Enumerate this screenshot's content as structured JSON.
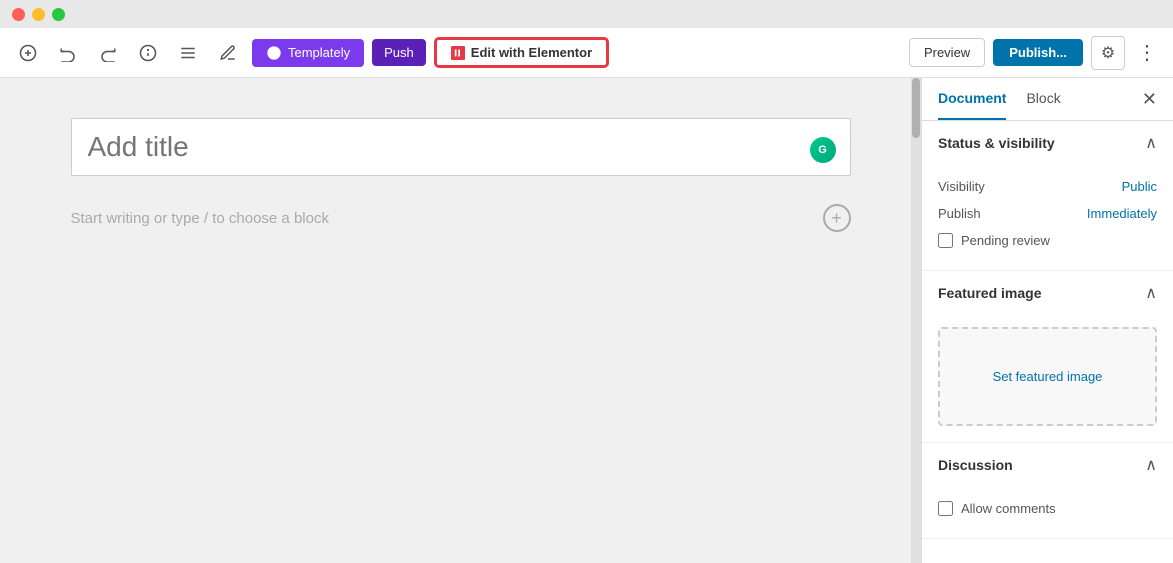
{
  "titlebar": {
    "lights": [
      "red",
      "yellow",
      "green"
    ]
  },
  "toolbar": {
    "undo_icon": "↩",
    "redo_icon": "↪",
    "info_icon": "ℹ",
    "list_icon": "≡",
    "edit_icon": "✎",
    "templately_label": "Templately",
    "push_label": "Push",
    "elementor_label": "Edit with Elementor",
    "preview_label": "Preview",
    "publish_label": "Publish...",
    "gear_icon": "⚙",
    "more_icon": "⋮"
  },
  "editor": {
    "title_placeholder": "Add title",
    "content_placeholder": "Start writing or type / to choose a block",
    "add_block_label": "+"
  },
  "sidebar": {
    "tab_document": "Document",
    "tab_block": "Block",
    "close_icon": "✕",
    "sections": {
      "status_visibility": {
        "title": "Status & visibility",
        "visibility_label": "Visibility",
        "visibility_value": "Public",
        "publish_label": "Publish",
        "publish_value": "Immediately",
        "pending_review_label": "Pending review"
      },
      "featured_image": {
        "title": "Featured image",
        "set_image_label": "Set featured image"
      },
      "discussion": {
        "title": "Discussion",
        "allow_comments_label": "Allow comments"
      }
    }
  }
}
